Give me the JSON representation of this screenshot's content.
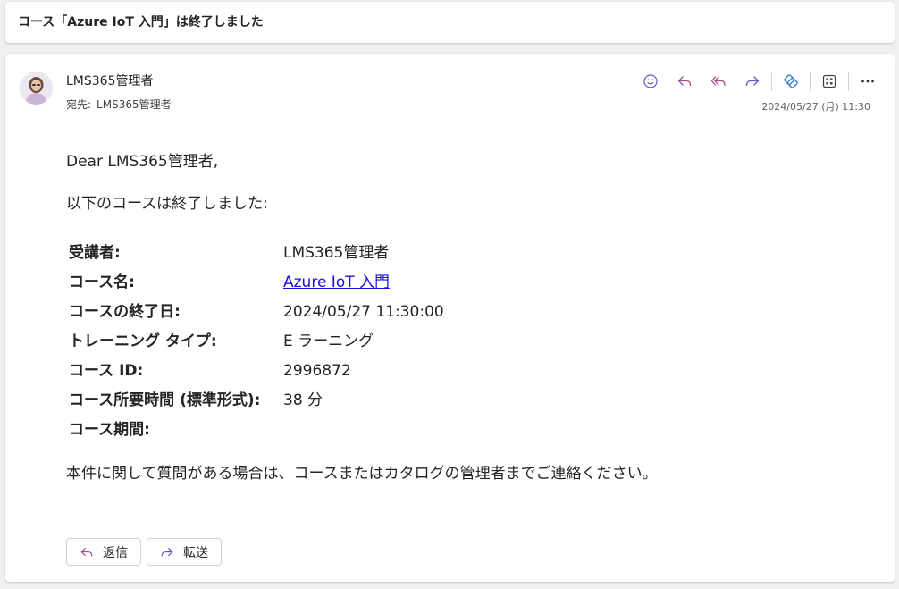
{
  "subject": "コース「Azure IoT 入門」は終了しました",
  "message": {
    "sender": "LMS365管理者",
    "to_label": "宛先:",
    "recipient": "LMS365管理者",
    "date": "2024/05/27 (月) 11:30"
  },
  "toolbar": {
    "icons": [
      "smiley-icon",
      "reply-icon",
      "reply-all-icon",
      "forward-icon",
      "loop-icon",
      "apps-icon",
      "more-icon"
    ],
    "accent_color": "#5b5fc7",
    "reply_color": "#a34d8a"
  },
  "body": {
    "greeting": "Dear LMS365管理者,",
    "intro": "以下のコースは終了しました:",
    "details": [
      {
        "label": "受講者:",
        "value": "LMS365管理者"
      },
      {
        "label": "コース名:",
        "value": "Azure IoT 入門",
        "link": true
      },
      {
        "label": "コースの終了日:",
        "value": "2024/05/27 11:30:00"
      },
      {
        "label": "トレーニング タイプ:",
        "value": "E ラーニング"
      },
      {
        "label": "コース ID:",
        "value": "2996872"
      },
      {
        "label": "コース所要時間 (標準形式):",
        "value": "38 分"
      },
      {
        "label": "コース期間:",
        "value": ""
      }
    ],
    "footer": "本件に関して質問がある場合は、コースまたはカタログの管理者までご連絡ください。"
  },
  "actions": {
    "reply_label": "返信",
    "forward_label": "転送"
  }
}
